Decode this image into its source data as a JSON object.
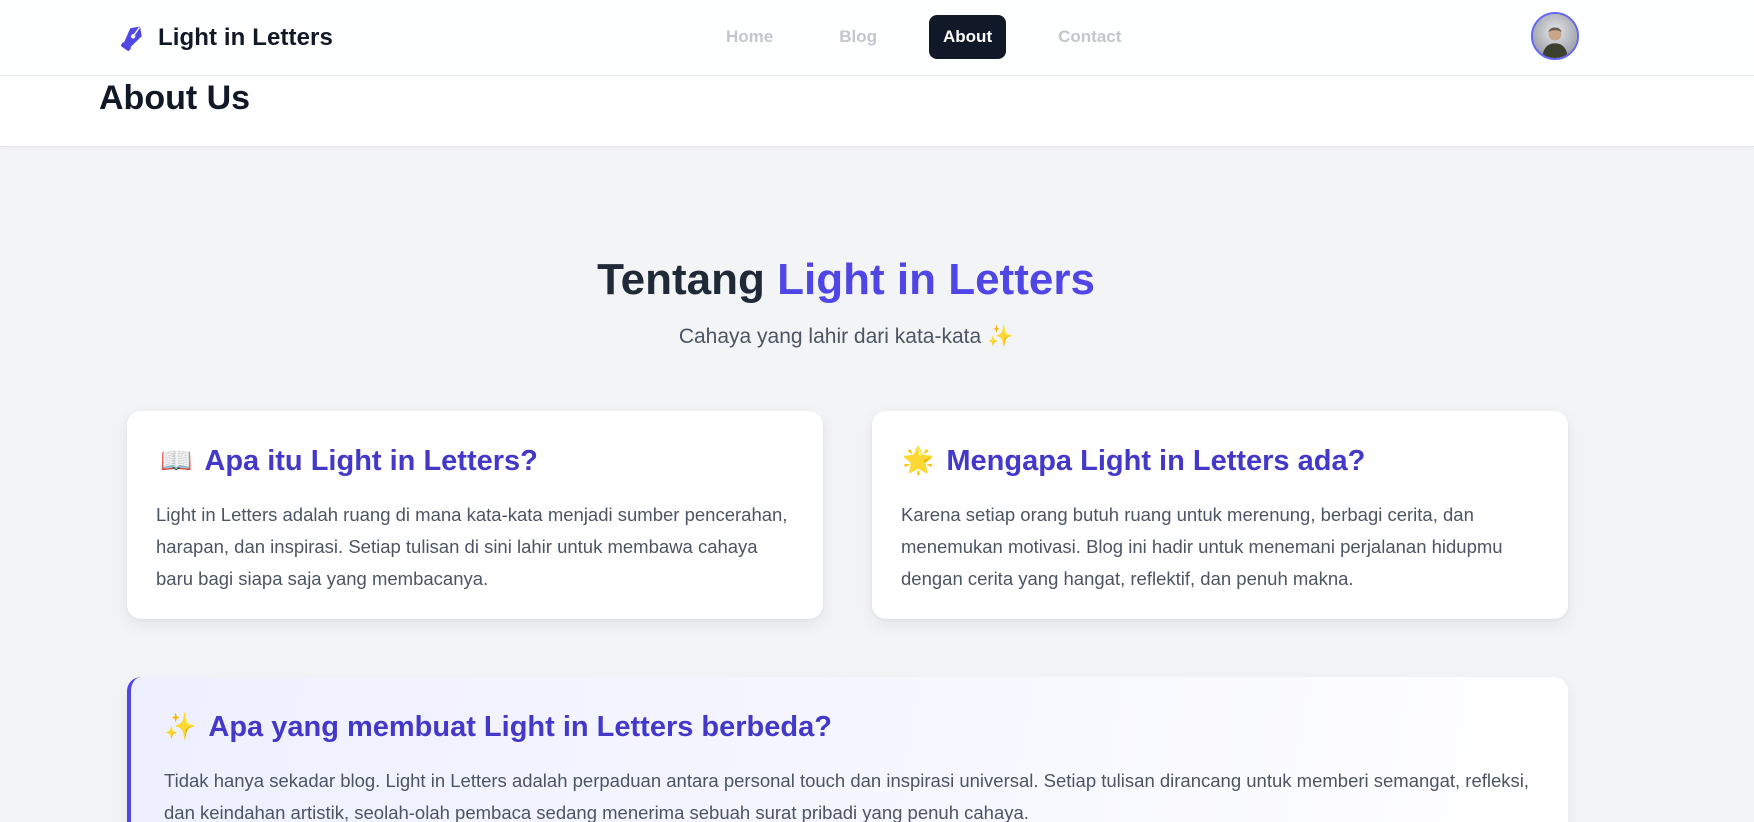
{
  "nav": {
    "brand": "Light in Letters",
    "brand_icon": "pen-nib-icon",
    "links": [
      {
        "label": "Home",
        "active": false
      },
      {
        "label": "Blog",
        "active": false
      },
      {
        "label": "About",
        "active": true
      },
      {
        "label": "Contact",
        "active": false
      }
    ],
    "avatar_icon": "user-avatar"
  },
  "header": {
    "title": "About Us"
  },
  "hero": {
    "title_prefix": "Tentang",
    "title_accent": "Light in Letters",
    "subtitle": "Cahaya yang lahir dari kata-kata ✨"
  },
  "cards": [
    {
      "emoji": "📖",
      "title": "Apa itu Light in Letters?",
      "text": "Light in Letters adalah ruang di mana kata-kata menjadi sumber pencerahan, harapan, dan inspirasi. Setiap tulisan di sini lahir untuk membawa cahaya baru bagi siapa saja yang membacanya."
    },
    {
      "emoji": "🌟",
      "title": "Mengapa Light in Letters ada?",
      "text": "Karena setiap orang butuh ruang untuk merenung, berbagi cerita, dan menemukan motivasi. Blog ini hadir untuk menemani perjalanan hidupmu dengan cerita yang hangat, reflektif, dan penuh makna."
    }
  ],
  "feature": {
    "emoji": "✨",
    "title": "Apa yang membuat Light in Letters berbeda?",
    "text": "Tidak hanya sekadar blog. Light in Letters adalah perpaduan antara personal touch dan inspirasi universal. Setiap tulisan dirancang untuk memberi semangat, refleksi, dan keindahan artistik, seolah-olah pembaca sedang menerima sebuah surat pribadi yang penuh cahaya."
  },
  "colors": {
    "accent": "#4f46e5",
    "heading_accent": "#4338ca",
    "nav_active_bg": "#111827",
    "page_bg": "#f3f4f6"
  }
}
